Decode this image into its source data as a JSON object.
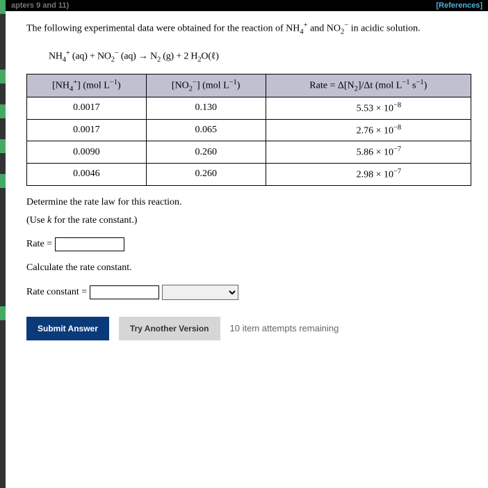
{
  "header": {
    "left": "apters 9 and 11)",
    "references": "[References]"
  },
  "problem": {
    "intro_pre": "The following experimental data were obtained for the reaction of NH",
    "intro_sub1": "4",
    "intro_sup1": "+",
    "intro_mid": " and NO",
    "intro_sub2": "2",
    "intro_sup2": "−",
    "intro_post": " in acidic solution.",
    "equation_html": "NH4+ (aq) + NO2− (aq) → N2 (g) + 2 H2O(ℓ)"
  },
  "table": {
    "head_col1": "[NH4+] (mol L−1)",
    "head_col2": "[NO2−] (mol L−1)",
    "head_col3": "Rate = Δ[N2]/Δt (mol L−1 s−1)",
    "rows": [
      {
        "c1": "0.0017",
        "c2": "0.130",
        "c3_num": "5.53 × 10",
        "c3_exp": "−8"
      },
      {
        "c1": "0.0017",
        "c2": "0.065",
        "c3_num": "2.76 × 10",
        "c3_exp": "−8"
      },
      {
        "c1": "0.0090",
        "c2": "0.260",
        "c3_num": "5.86 × 10",
        "c3_exp": "−7"
      },
      {
        "c1": "0.0046",
        "c2": "0.260",
        "c3_num": "2.98 × 10",
        "c3_exp": "−7"
      }
    ]
  },
  "prompts": {
    "p1": "Determine the rate law for this reaction.",
    "p2_pre": "(Use ",
    "p2_k": "k",
    "p2_post": " for the rate constant.)",
    "rate_label": "Rate =",
    "p3": "Calculate the rate constant.",
    "const_label": "Rate constant ="
  },
  "buttons": {
    "submit": "Submit Answer",
    "try": "Try Another Version",
    "remaining": "10 item attempts remaining"
  }
}
